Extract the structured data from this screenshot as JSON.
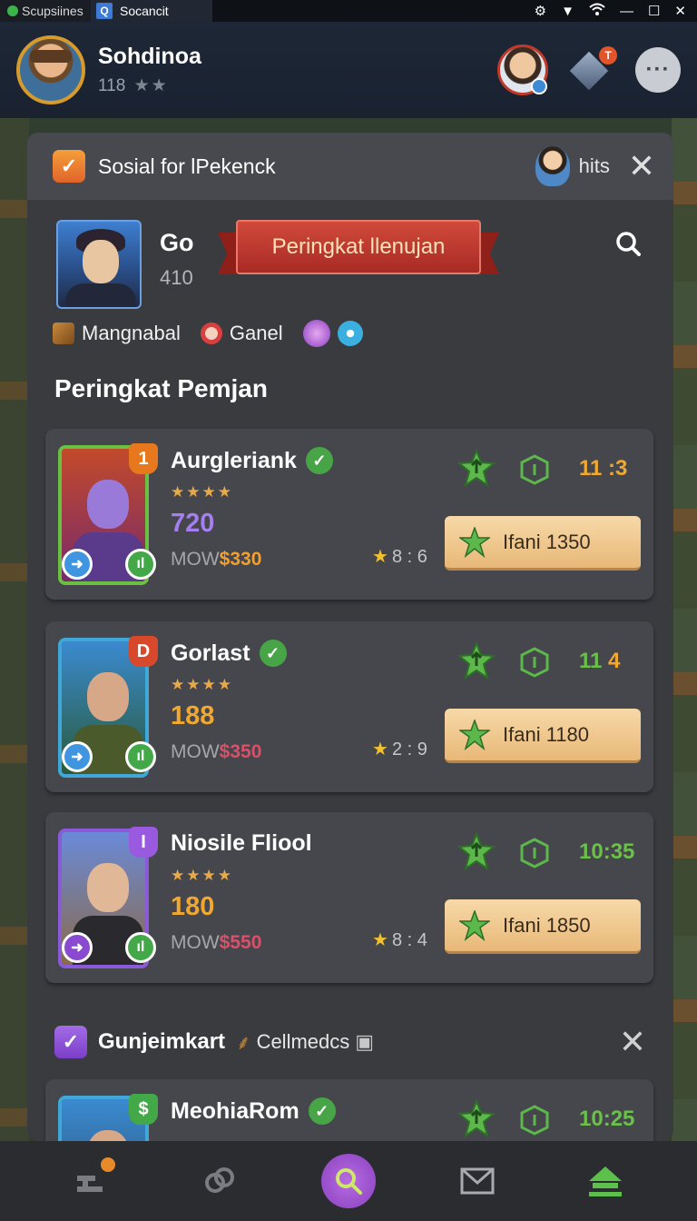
{
  "statusbar": {
    "app1": "Scupsiines",
    "app2": "Socancit",
    "app2_icon": "Q"
  },
  "header": {
    "username": "Sohdinoa",
    "level": "118",
    "stars": "★★",
    "gem_badge": "T"
  },
  "panel": {
    "title": "Sosial for lPekenck",
    "hits_label": "hits",
    "profile": {
      "name": "Go",
      "sub": "410"
    },
    "ribbon_label": "Peringkat llenujan",
    "tags": [
      "Mangnabal",
      "Ganel"
    ],
    "section_title": "Peringkat Pemjan",
    "cards": [
      {
        "rank": "1",
        "name": "Aurgleriank",
        "stars": "★★★★",
        "score": "720",
        "price_label": "MOW",
        "price": "$330",
        "rating": "8 : 6",
        "time_a": "11",
        "time_b": ":3",
        "cta": "Ifani 1350",
        "score_color": "#a57ef0",
        "price_color": "#f0a030"
      },
      {
        "rank": "D",
        "name": "Gorlast",
        "stars": "★★★★",
        "score": "188",
        "price_label": "MOW",
        "price": "$350",
        "rating": "2 : 9",
        "time_a": "11",
        "time_b": "4",
        "cta": "Ifani 1180",
        "score_color": "#f0a830",
        "price_color": "#d9506a"
      },
      {
        "rank": "I",
        "name": "Niosile Fliool",
        "stars": "★★★★",
        "score": "180",
        "price_label": "MOW",
        "price": "$550",
        "rating": "8 : 4",
        "time_a": "10:35",
        "time_b": "",
        "cta": "Ifani 1850",
        "score_color": "#f0a830",
        "price_color": "#d9506a"
      },
      {
        "rank": "",
        "name": "MeohiaRom",
        "stars": "",
        "score": "",
        "price_label": "",
        "price": "",
        "rating": "",
        "time_a": "10:25",
        "time_b": "",
        "cta": "",
        "score_color": "#f0a830",
        "price_color": "#d9506a"
      }
    ],
    "section2": {
      "title": "Gunjeimkart",
      "tag": "Cellmedcs"
    }
  },
  "nav": {
    "items": [
      "tools-icon",
      "link-icon",
      "search-icon",
      "mail-icon",
      "home-icon"
    ]
  }
}
